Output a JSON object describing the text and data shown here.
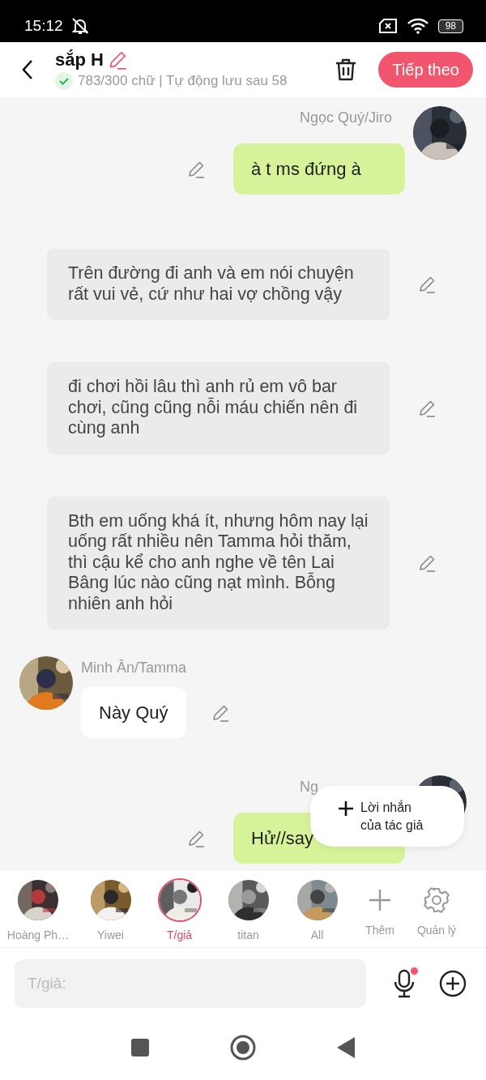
{
  "status_bar": {
    "time": "15:12",
    "battery": "98"
  },
  "header": {
    "title": "sắp H",
    "word_count": "783/300 chữ | Tự động lưu sau 58",
    "saved": true,
    "next_button": "Tiếp theo"
  },
  "messages": [
    {
      "kind": "outgoing",
      "sender": "Ngọc Quý/Jiro",
      "text": "à t ms đứng à"
    },
    {
      "kind": "narration",
      "text": "Trên đường đi anh và em nói chuyện rất vui vẻ, cứ như hai vợ chồng vậy"
    },
    {
      "kind": "narration",
      "text": "đi chơi hồi lâu thì anh rủ em vô bar chơi,  cũng cũng nỗi máu chiến nên đi cùng anh"
    },
    {
      "kind": "narration",
      "text": "Bth em uống khá ít, nhưng hôm nay lại uống rất nhiều nên Tamma hỏi thăm, thì cậu kể cho anh nghe về tên Lai Bâng lúc nào cũng nạt mình. Bỗng nhiên anh hỏi"
    },
    {
      "kind": "incoming",
      "sender": "Minh Ân/Tamma",
      "text": "Này Quý"
    },
    {
      "kind": "outgoing",
      "sender": "Ng",
      "text": "Hử//say"
    }
  ],
  "author_note_button": {
    "label": "Lời nhắn\ncủa tác giả"
  },
  "characters": [
    {
      "name": "Hoàng Ph…",
      "selected": false
    },
    {
      "name": "Yiwei",
      "selected": false
    },
    {
      "name": "T/giả",
      "selected": true
    },
    {
      "name": "titan",
      "selected": false
    },
    {
      "name": "All",
      "selected": false
    }
  ],
  "character_actions": [
    {
      "kind": "add",
      "label": "Thêm"
    },
    {
      "kind": "manage",
      "label": "Quản lý"
    }
  ],
  "composer": {
    "placeholder": "T/giả:",
    "mic_badge": true
  }
}
